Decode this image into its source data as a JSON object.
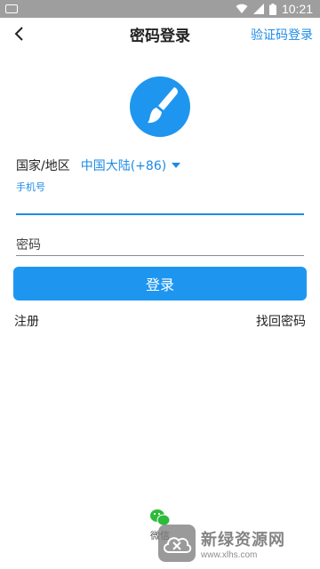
{
  "status_bar": {
    "time": "10:21"
  },
  "app_bar": {
    "title": "密码登录",
    "right_link": "验证码登录"
  },
  "form": {
    "region_label": "国家/地区",
    "region_value": "中国大陆(+86)",
    "phone_label": "手机号",
    "phone_value": "",
    "password_placeholder": "密码",
    "login_button": "登录",
    "register_link": "注册",
    "forgot_link": "找回密码"
  },
  "third_party": {
    "wechat_label": "微信"
  },
  "watermark": {
    "title": "新绿资源网",
    "url": "www.xlhs.com"
  },
  "colors": {
    "accent": "#1e96f0",
    "link": "#1e8be6",
    "status_bar": "#9e9e9e"
  }
}
